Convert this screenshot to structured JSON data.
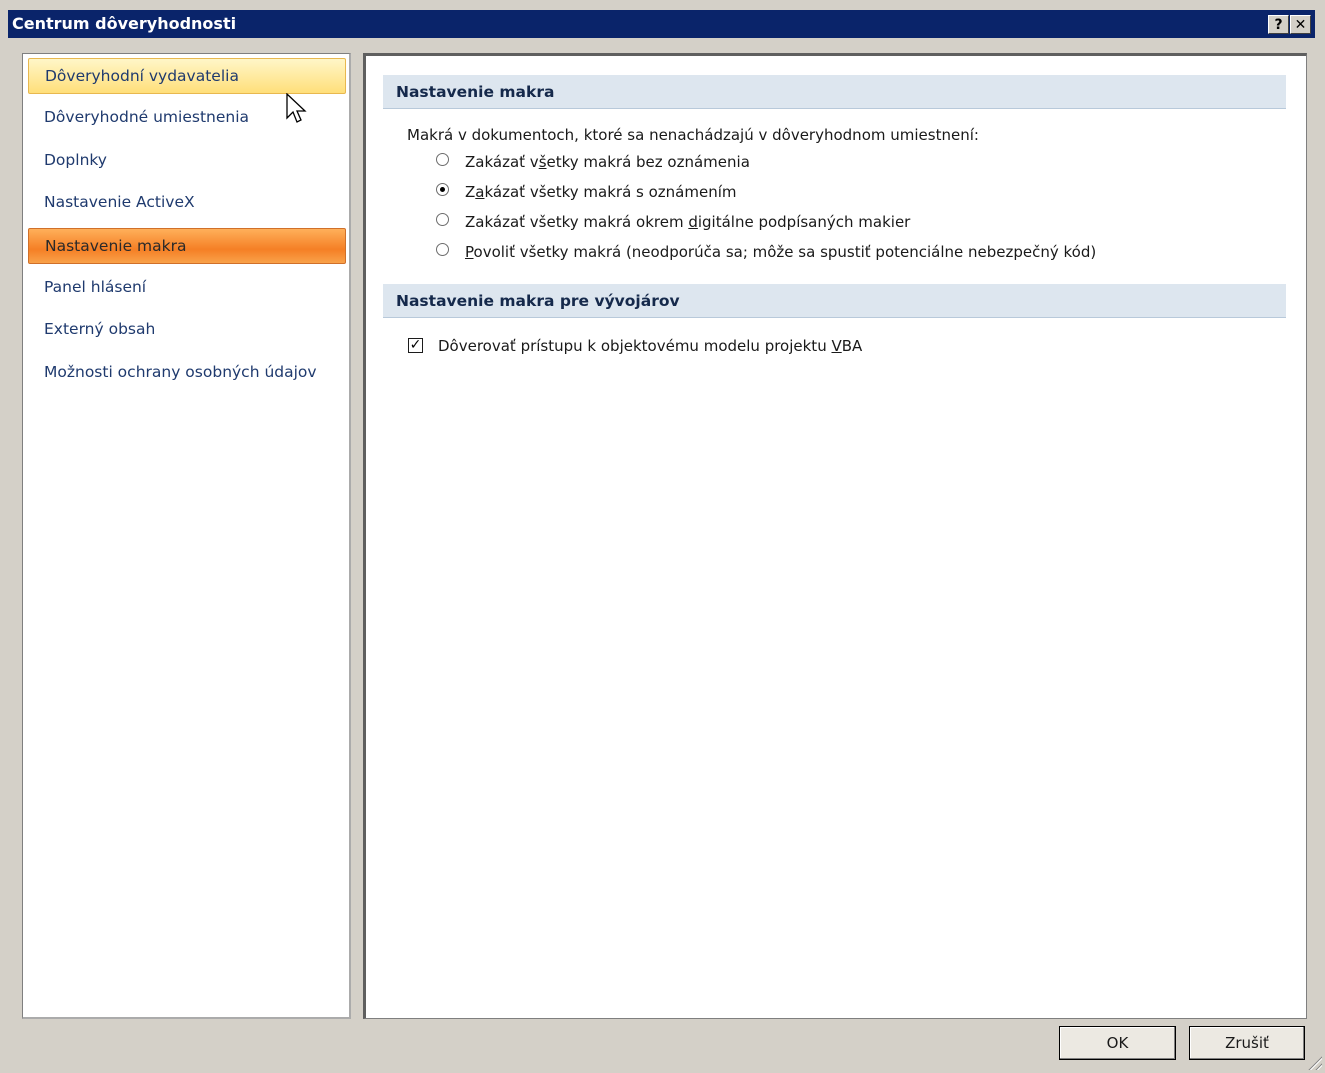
{
  "window": {
    "title": "Centrum dôveryhodnosti",
    "help_glyph": "?",
    "close_glyph": "✕"
  },
  "sidebar": {
    "items": [
      {
        "label": "Dôveryhodní vydavatelia",
        "state": "hover"
      },
      {
        "label": "Dôveryhodné umiestnenia",
        "state": "normal"
      },
      {
        "label": "Doplnky",
        "state": "normal"
      },
      {
        "label": "Nastavenie ActiveX",
        "state": "normal"
      },
      {
        "label": "Nastavenie makra",
        "state": "selected"
      },
      {
        "label": "Panel hlásení",
        "state": "normal"
      },
      {
        "label": "Externý obsah",
        "state": "normal"
      },
      {
        "label": "Možnosti ochrany osobných údajov",
        "state": "normal"
      }
    ]
  },
  "macro_settings": {
    "header": "Nastavenie makra",
    "description": "Makrá v dokumentoch, ktoré sa nenachádzajú v dôveryhodnom umiestnení:",
    "options": [
      {
        "label": "Zakázať všetky makrá bez oznámenia",
        "checked": false
      },
      {
        "label": "Zakázať všetky makrá s oznámením",
        "checked": true
      },
      {
        "label": "Zakázať všetky makrá okrem digitálne podpísaných makier",
        "checked": false
      },
      {
        "label": "Povoliť všetky makrá (neodporúča sa; môže sa spustiť potenciálne nebezpečný kód)",
        "checked": false
      }
    ]
  },
  "developer_settings": {
    "header": "Nastavenie makra pre vývojárov",
    "trust_vba": {
      "label": "Dôverovať prístupu k objektovému modelu projektu VBA",
      "checked": true
    }
  },
  "buttons": {
    "ok": "OK",
    "cancel": "Zrušiť"
  },
  "colors": {
    "title_bar": "#0a246a",
    "nav_selected": "#f57f25",
    "nav_hover": "#ffdf7a",
    "section_header_bg": "#dde6ef"
  }
}
